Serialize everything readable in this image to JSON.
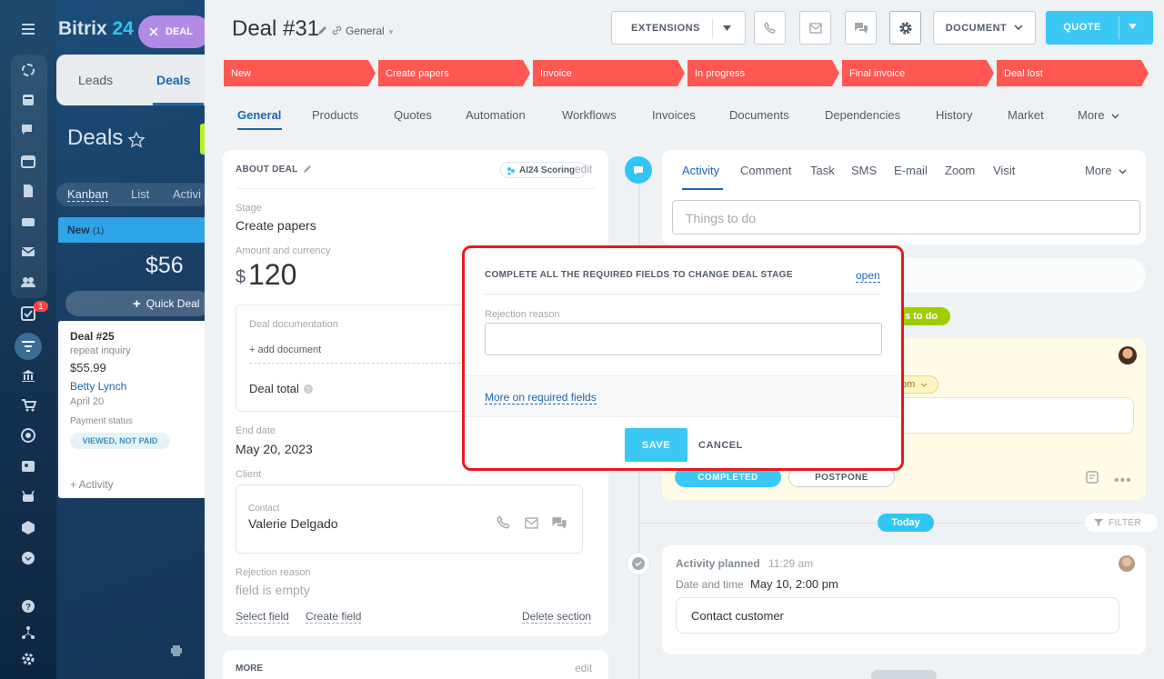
{
  "bg": {
    "brand": "Bitrix",
    "brand_num": "24",
    "deal_chip": "DEAL",
    "tabs": [
      "Leads",
      "Deals"
    ],
    "title": "Deals",
    "views": [
      "Kanban",
      "List",
      "Activi"
    ],
    "column": {
      "name": "New",
      "count": "(1)",
      "sum": "$56",
      "quick_deal": "Quick Deal"
    },
    "card": {
      "title": "Deal #25",
      "subtitle": "repeat inquiry",
      "amount": "$55.99",
      "contact": "Betty Lynch",
      "date": "April 20",
      "payment_label": "Payment status",
      "payment_status": "VIEWED, NOT PAID",
      "activity": "+ Activity"
    },
    "rail_badge": "1"
  },
  "header": {
    "title": "Deal #31",
    "category": "General",
    "buttons": {
      "extensions": "EXTENSIONS",
      "document": "DOCUMENT",
      "quote": "QUOTE"
    }
  },
  "stages": [
    "New",
    "Create papers",
    "Invoice",
    "In progress",
    "Final invoice",
    "Deal lost"
  ],
  "stage_color": "#ff5752",
  "tabs": [
    "General",
    "Products",
    "Quotes",
    "Automation",
    "Workflows",
    "Invoices",
    "Documents",
    "Dependencies",
    "History",
    "Market",
    "More"
  ],
  "about": {
    "heading": "ABOUT DEAL",
    "ai_scoring": "AI24 Scoring",
    "edit": "edit",
    "stage_label": "Stage",
    "stage_value": "Create papers",
    "amount_label": "Amount and currency",
    "currency": "$",
    "amount": "120",
    "doc_label": "Deal documentation",
    "add_document": "+ add document",
    "deal_total": "Deal total",
    "end_label": "End date",
    "end_value": "May 20, 2023",
    "client_label": "Client",
    "contact_label": "Contact",
    "contact_name": "Valerie Delgado",
    "rejection_label": "Rejection reason",
    "rejection_value": "field is empty",
    "select_field": "Select field",
    "create_field": "Create field",
    "delete_section": "Delete section",
    "more_heading": "MORE",
    "more_edit": "edit"
  },
  "activity": {
    "tabs": [
      "Activity",
      "Comment",
      "Task",
      "SMS",
      "E-mail",
      "Zoom",
      "Visit",
      "More"
    ],
    "input_placeholder": "Things to do",
    "todo_pill": "s to do",
    "pm_pill": "pm",
    "completed": "COMPLETED",
    "postpone": "POSTPONE",
    "today": "Today",
    "filter": "FILTER",
    "planned_title": "Activity planned",
    "planned_time": "11:29 am",
    "date_label": "Date and time",
    "date_value": "May 10, 2:00 pm",
    "contact_customer": "Contact customer"
  },
  "modal": {
    "title": "COMPLETE ALL THE REQUIRED FIELDS TO CHANGE DEAL STAGE",
    "open": "open",
    "field_label": "Rejection reason",
    "field_value": "",
    "more_link": "More on required fields",
    "save": "SAVE",
    "cancel": "CANCEL",
    "highlight_color": "#e8191d"
  }
}
